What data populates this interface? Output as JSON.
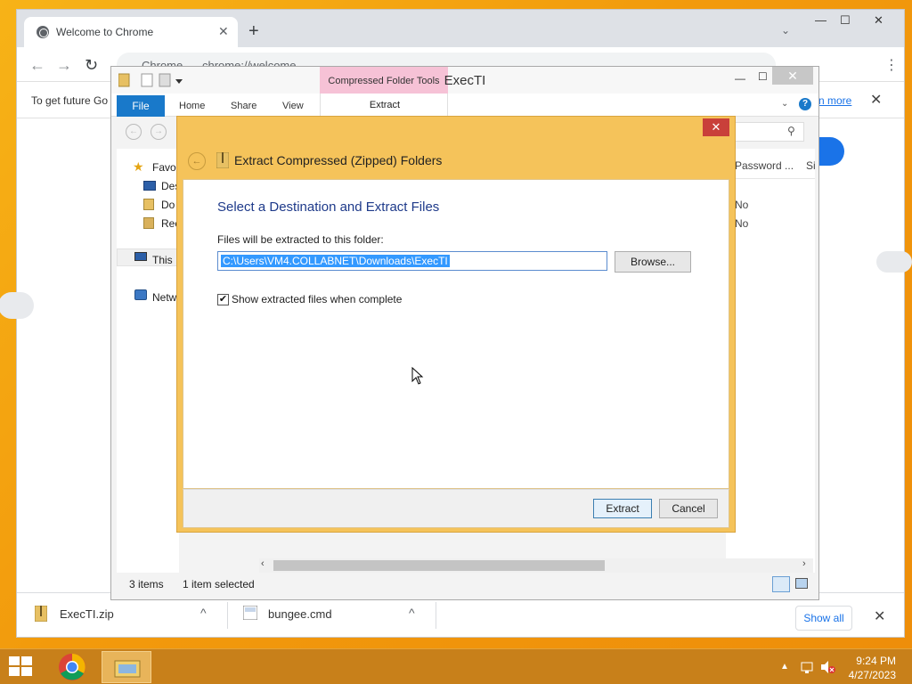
{
  "chrome": {
    "tab_title": "Welcome to Chrome",
    "new_tab": "+",
    "tab_close": "✕",
    "tab_search": "⌄",
    "minimize": "—",
    "maximize": "☐",
    "close": "✕",
    "back": "←",
    "forward": "→",
    "reload": "↻",
    "omnibox_site": "Chrome",
    "omnibox_url": "chrome://welcome",
    "infobar_text": "To get future Go",
    "infobar_link": "n more",
    "infobar_close": "✕",
    "menu": "⋮"
  },
  "downloads": {
    "items": [
      {
        "name": "ExecTI.zip",
        "icon": "zip-icon"
      },
      {
        "name": "bungee.cmd",
        "icon": "cmd-icon"
      }
    ],
    "chevron": "^",
    "show_all": "Show all",
    "close": "✕"
  },
  "explorer": {
    "title": "ExecTI",
    "context_tab": "Compressed Folder Tools",
    "ribbon_tabs": [
      "File",
      "Home",
      "Share",
      "View"
    ],
    "extract_tab": "Extract",
    "help": "?",
    "nav_items": [
      {
        "label": "Favor",
        "icon": "star-icon"
      },
      {
        "label": "Des",
        "icon": "desktop-icon"
      },
      {
        "label": "Do",
        "icon": "downloads-icon"
      },
      {
        "label": "Rec",
        "icon": "recent-icon"
      },
      {
        "label": "This I",
        "icon": "computer-icon"
      },
      {
        "label": "Netw",
        "icon": "network-icon"
      }
    ],
    "columns": [
      "Password ...",
      "Si"
    ],
    "rows": [
      "No",
      "No"
    ],
    "status_items": "3 items",
    "status_selected": "1 item selected"
  },
  "dialog": {
    "title": "Extract Compressed (Zipped) Folders",
    "heading": "Select a Destination and Extract Files",
    "label": "Files will be extracted to this folder:",
    "path": "C:\\Users\\VM4.COLLABNET\\Downloads\\ExecTI",
    "browse": "Browse...",
    "checkbox_label": "Show extracted files when complete",
    "checkbox_checked": true,
    "extract": "Extract",
    "cancel": "Cancel",
    "close": "✕",
    "back": "←"
  },
  "taskbar": {
    "time": "9:24 PM",
    "date": "4/27/2023",
    "tray_up": "▲"
  }
}
